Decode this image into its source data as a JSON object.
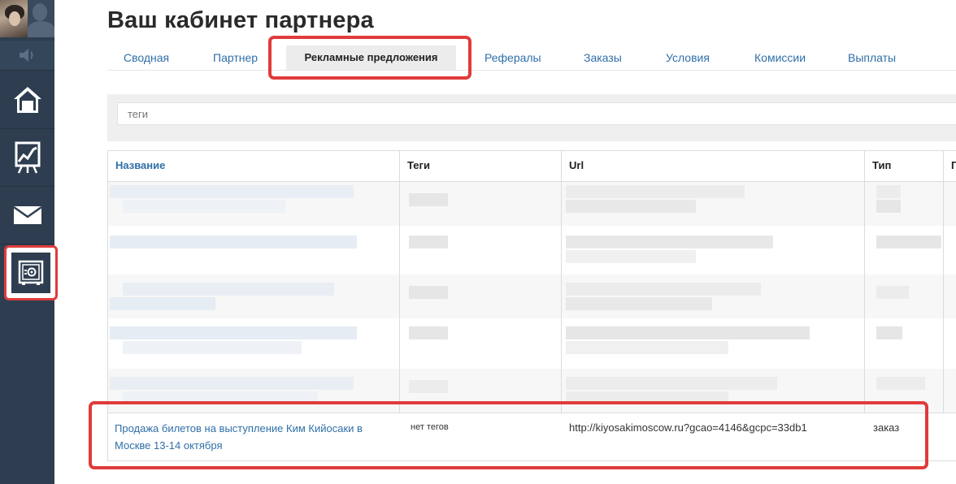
{
  "page": {
    "title": "Ваш кабинет партнера"
  },
  "sidebar": {
    "items": [
      {
        "icon": "home-icon"
      },
      {
        "icon": "chart-icon"
      },
      {
        "icon": "mail-icon"
      },
      {
        "icon": "safe-icon",
        "active": true
      }
    ]
  },
  "tabs": [
    {
      "label": "Сводная"
    },
    {
      "label": "Партнер"
    },
    {
      "label": "Рекламные предложения",
      "active": true
    },
    {
      "label": "Рефералы"
    },
    {
      "label": "Заказы"
    },
    {
      "label": "Условия"
    },
    {
      "label": "Комиссии"
    },
    {
      "label": "Выплаты"
    }
  ],
  "search": {
    "placeholder": "теги"
  },
  "table": {
    "columns": [
      "Название",
      "Теги",
      "Url",
      "Тип",
      "П"
    ],
    "rows": [
      {
        "name": "Продажа билетов на выступление Ким Кийосаки в Москве 13-14 октября",
        "tags": "нет тегов",
        "url": "http://kiyosakimoscow.ru?gcao=4146&gcpc=33db1",
        "type": "заказ"
      }
    ]
  },
  "colors": {
    "accent": "#2f6fa8",
    "highlight": "#e03b3b",
    "sidebar": "#2e3e50"
  }
}
